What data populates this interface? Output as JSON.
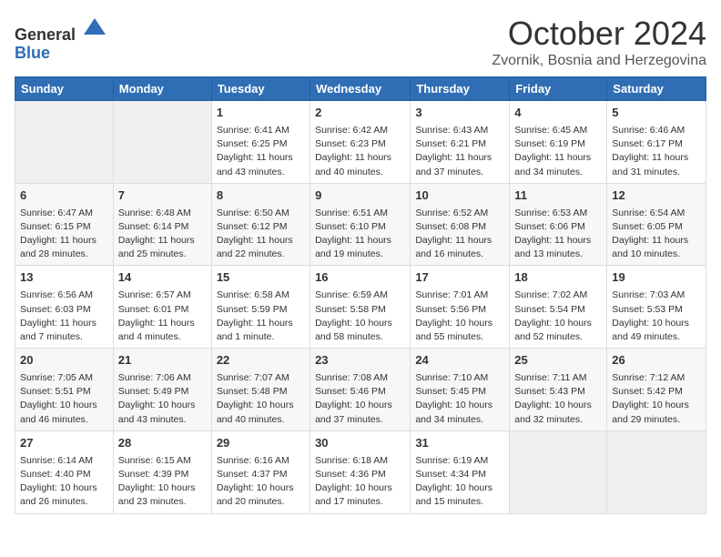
{
  "header": {
    "logo_line1": "General",
    "logo_line2": "Blue",
    "month": "October 2024",
    "location": "Zvornik, Bosnia and Herzegovina"
  },
  "weekdays": [
    "Sunday",
    "Monday",
    "Tuesday",
    "Wednesday",
    "Thursday",
    "Friday",
    "Saturday"
  ],
  "weeks": [
    [
      {
        "day": "",
        "sunrise": "",
        "sunset": "",
        "daylight": ""
      },
      {
        "day": "",
        "sunrise": "",
        "sunset": "",
        "daylight": ""
      },
      {
        "day": "1",
        "sunrise": "Sunrise: 6:41 AM",
        "sunset": "Sunset: 6:25 PM",
        "daylight": "Daylight: 11 hours and 43 minutes."
      },
      {
        "day": "2",
        "sunrise": "Sunrise: 6:42 AM",
        "sunset": "Sunset: 6:23 PM",
        "daylight": "Daylight: 11 hours and 40 minutes."
      },
      {
        "day": "3",
        "sunrise": "Sunrise: 6:43 AM",
        "sunset": "Sunset: 6:21 PM",
        "daylight": "Daylight: 11 hours and 37 minutes."
      },
      {
        "day": "4",
        "sunrise": "Sunrise: 6:45 AM",
        "sunset": "Sunset: 6:19 PM",
        "daylight": "Daylight: 11 hours and 34 minutes."
      },
      {
        "day": "5",
        "sunrise": "Sunrise: 6:46 AM",
        "sunset": "Sunset: 6:17 PM",
        "daylight": "Daylight: 11 hours and 31 minutes."
      }
    ],
    [
      {
        "day": "6",
        "sunrise": "Sunrise: 6:47 AM",
        "sunset": "Sunset: 6:15 PM",
        "daylight": "Daylight: 11 hours and 28 minutes."
      },
      {
        "day": "7",
        "sunrise": "Sunrise: 6:48 AM",
        "sunset": "Sunset: 6:14 PM",
        "daylight": "Daylight: 11 hours and 25 minutes."
      },
      {
        "day": "8",
        "sunrise": "Sunrise: 6:50 AM",
        "sunset": "Sunset: 6:12 PM",
        "daylight": "Daylight: 11 hours and 22 minutes."
      },
      {
        "day": "9",
        "sunrise": "Sunrise: 6:51 AM",
        "sunset": "Sunset: 6:10 PM",
        "daylight": "Daylight: 11 hours and 19 minutes."
      },
      {
        "day": "10",
        "sunrise": "Sunrise: 6:52 AM",
        "sunset": "Sunset: 6:08 PM",
        "daylight": "Daylight: 11 hours and 16 minutes."
      },
      {
        "day": "11",
        "sunrise": "Sunrise: 6:53 AM",
        "sunset": "Sunset: 6:06 PM",
        "daylight": "Daylight: 11 hours and 13 minutes."
      },
      {
        "day": "12",
        "sunrise": "Sunrise: 6:54 AM",
        "sunset": "Sunset: 6:05 PM",
        "daylight": "Daylight: 11 hours and 10 minutes."
      }
    ],
    [
      {
        "day": "13",
        "sunrise": "Sunrise: 6:56 AM",
        "sunset": "Sunset: 6:03 PM",
        "daylight": "Daylight: 11 hours and 7 minutes."
      },
      {
        "day": "14",
        "sunrise": "Sunrise: 6:57 AM",
        "sunset": "Sunset: 6:01 PM",
        "daylight": "Daylight: 11 hours and 4 minutes."
      },
      {
        "day": "15",
        "sunrise": "Sunrise: 6:58 AM",
        "sunset": "Sunset: 5:59 PM",
        "daylight": "Daylight: 11 hours and 1 minute."
      },
      {
        "day": "16",
        "sunrise": "Sunrise: 6:59 AM",
        "sunset": "Sunset: 5:58 PM",
        "daylight": "Daylight: 10 hours and 58 minutes."
      },
      {
        "day": "17",
        "sunrise": "Sunrise: 7:01 AM",
        "sunset": "Sunset: 5:56 PM",
        "daylight": "Daylight: 10 hours and 55 minutes."
      },
      {
        "day": "18",
        "sunrise": "Sunrise: 7:02 AM",
        "sunset": "Sunset: 5:54 PM",
        "daylight": "Daylight: 10 hours and 52 minutes."
      },
      {
        "day": "19",
        "sunrise": "Sunrise: 7:03 AM",
        "sunset": "Sunset: 5:53 PM",
        "daylight": "Daylight: 10 hours and 49 minutes."
      }
    ],
    [
      {
        "day": "20",
        "sunrise": "Sunrise: 7:05 AM",
        "sunset": "Sunset: 5:51 PM",
        "daylight": "Daylight: 10 hours and 46 minutes."
      },
      {
        "day": "21",
        "sunrise": "Sunrise: 7:06 AM",
        "sunset": "Sunset: 5:49 PM",
        "daylight": "Daylight: 10 hours and 43 minutes."
      },
      {
        "day": "22",
        "sunrise": "Sunrise: 7:07 AM",
        "sunset": "Sunset: 5:48 PM",
        "daylight": "Daylight: 10 hours and 40 minutes."
      },
      {
        "day": "23",
        "sunrise": "Sunrise: 7:08 AM",
        "sunset": "Sunset: 5:46 PM",
        "daylight": "Daylight: 10 hours and 37 minutes."
      },
      {
        "day": "24",
        "sunrise": "Sunrise: 7:10 AM",
        "sunset": "Sunset: 5:45 PM",
        "daylight": "Daylight: 10 hours and 34 minutes."
      },
      {
        "day": "25",
        "sunrise": "Sunrise: 7:11 AM",
        "sunset": "Sunset: 5:43 PM",
        "daylight": "Daylight: 10 hours and 32 minutes."
      },
      {
        "day": "26",
        "sunrise": "Sunrise: 7:12 AM",
        "sunset": "Sunset: 5:42 PM",
        "daylight": "Daylight: 10 hours and 29 minutes."
      }
    ],
    [
      {
        "day": "27",
        "sunrise": "Sunrise: 6:14 AM",
        "sunset": "Sunset: 4:40 PM",
        "daylight": "Daylight: 10 hours and 26 minutes."
      },
      {
        "day": "28",
        "sunrise": "Sunrise: 6:15 AM",
        "sunset": "Sunset: 4:39 PM",
        "daylight": "Daylight: 10 hours and 23 minutes."
      },
      {
        "day": "29",
        "sunrise": "Sunrise: 6:16 AM",
        "sunset": "Sunset: 4:37 PM",
        "daylight": "Daylight: 10 hours and 20 minutes."
      },
      {
        "day": "30",
        "sunrise": "Sunrise: 6:18 AM",
        "sunset": "Sunset: 4:36 PM",
        "daylight": "Daylight: 10 hours and 17 minutes."
      },
      {
        "day": "31",
        "sunrise": "Sunrise: 6:19 AM",
        "sunset": "Sunset: 4:34 PM",
        "daylight": "Daylight: 10 hours and 15 minutes."
      },
      {
        "day": "",
        "sunrise": "",
        "sunset": "",
        "daylight": ""
      },
      {
        "day": "",
        "sunrise": "",
        "sunset": "",
        "daylight": ""
      }
    ]
  ]
}
